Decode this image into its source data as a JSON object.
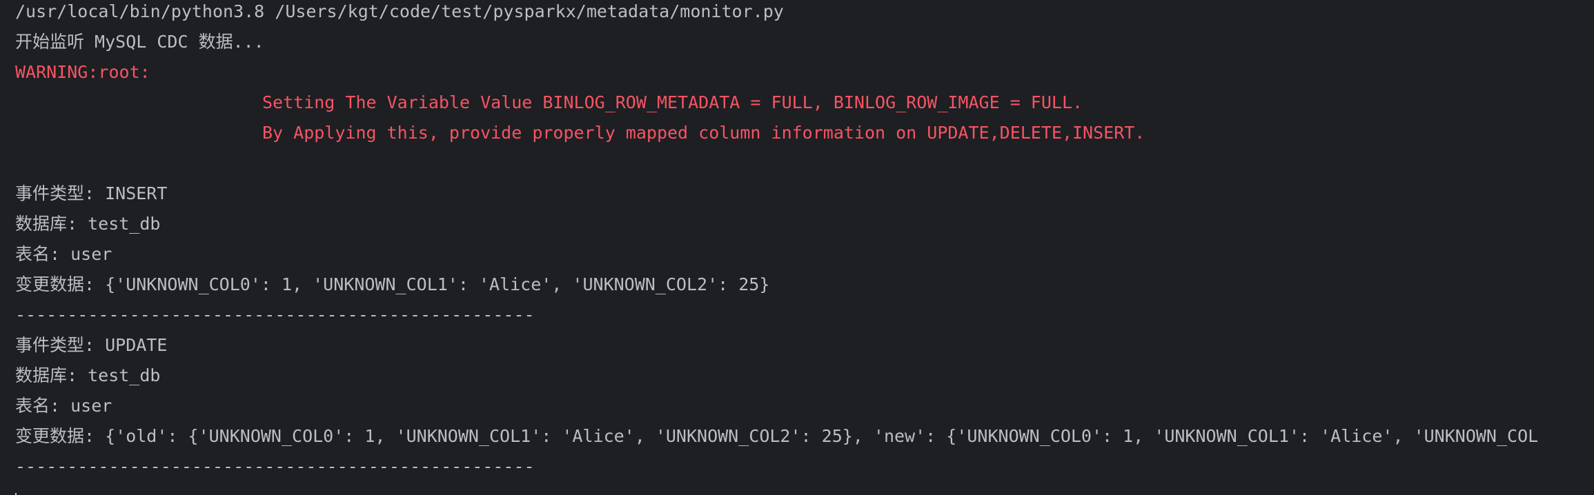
{
  "console": {
    "lines": {
      "l0": "/usr/local/bin/python3.8 /Users/kgt/code/test/pysparkx/metadata/monitor.py",
      "l1": "开始监听 MySQL CDC 数据...",
      "l2": "WARNING:root:",
      "l3": "Setting The Variable Value BINLOG_ROW_METADATA = FULL, BINLOG_ROW_IMAGE = FULL.",
      "l4": "By Applying this, provide properly mapped column information on UPDATE,DELETE,INSERT.",
      "l5": "",
      "l6": "事件类型: INSERT",
      "l7": "数据库: test_db",
      "l8": "表名: user",
      "l9": "变更数据: {'UNKNOWN_COL0': 1, 'UNKNOWN_COL1': 'Alice', 'UNKNOWN_COL2': 25}",
      "l10": "--------------------------------------------------",
      "l11": "事件类型: UPDATE",
      "l12": "数据库: test_db",
      "l13": "表名: user",
      "l14": "变更数据: {'old': {'UNKNOWN_COL0': 1, 'UNKNOWN_COL1': 'Alice', 'UNKNOWN_COL2': 25}, 'new': {'UNKNOWN_COL0': 1, 'UNKNOWN_COL1': 'Alice', 'UNKNOWN_COL",
      "l15": "--------------------------------------------------"
    },
    "colors": {
      "background": "#1e1f22",
      "text": "#bcbec4",
      "error": "#f75464"
    }
  }
}
